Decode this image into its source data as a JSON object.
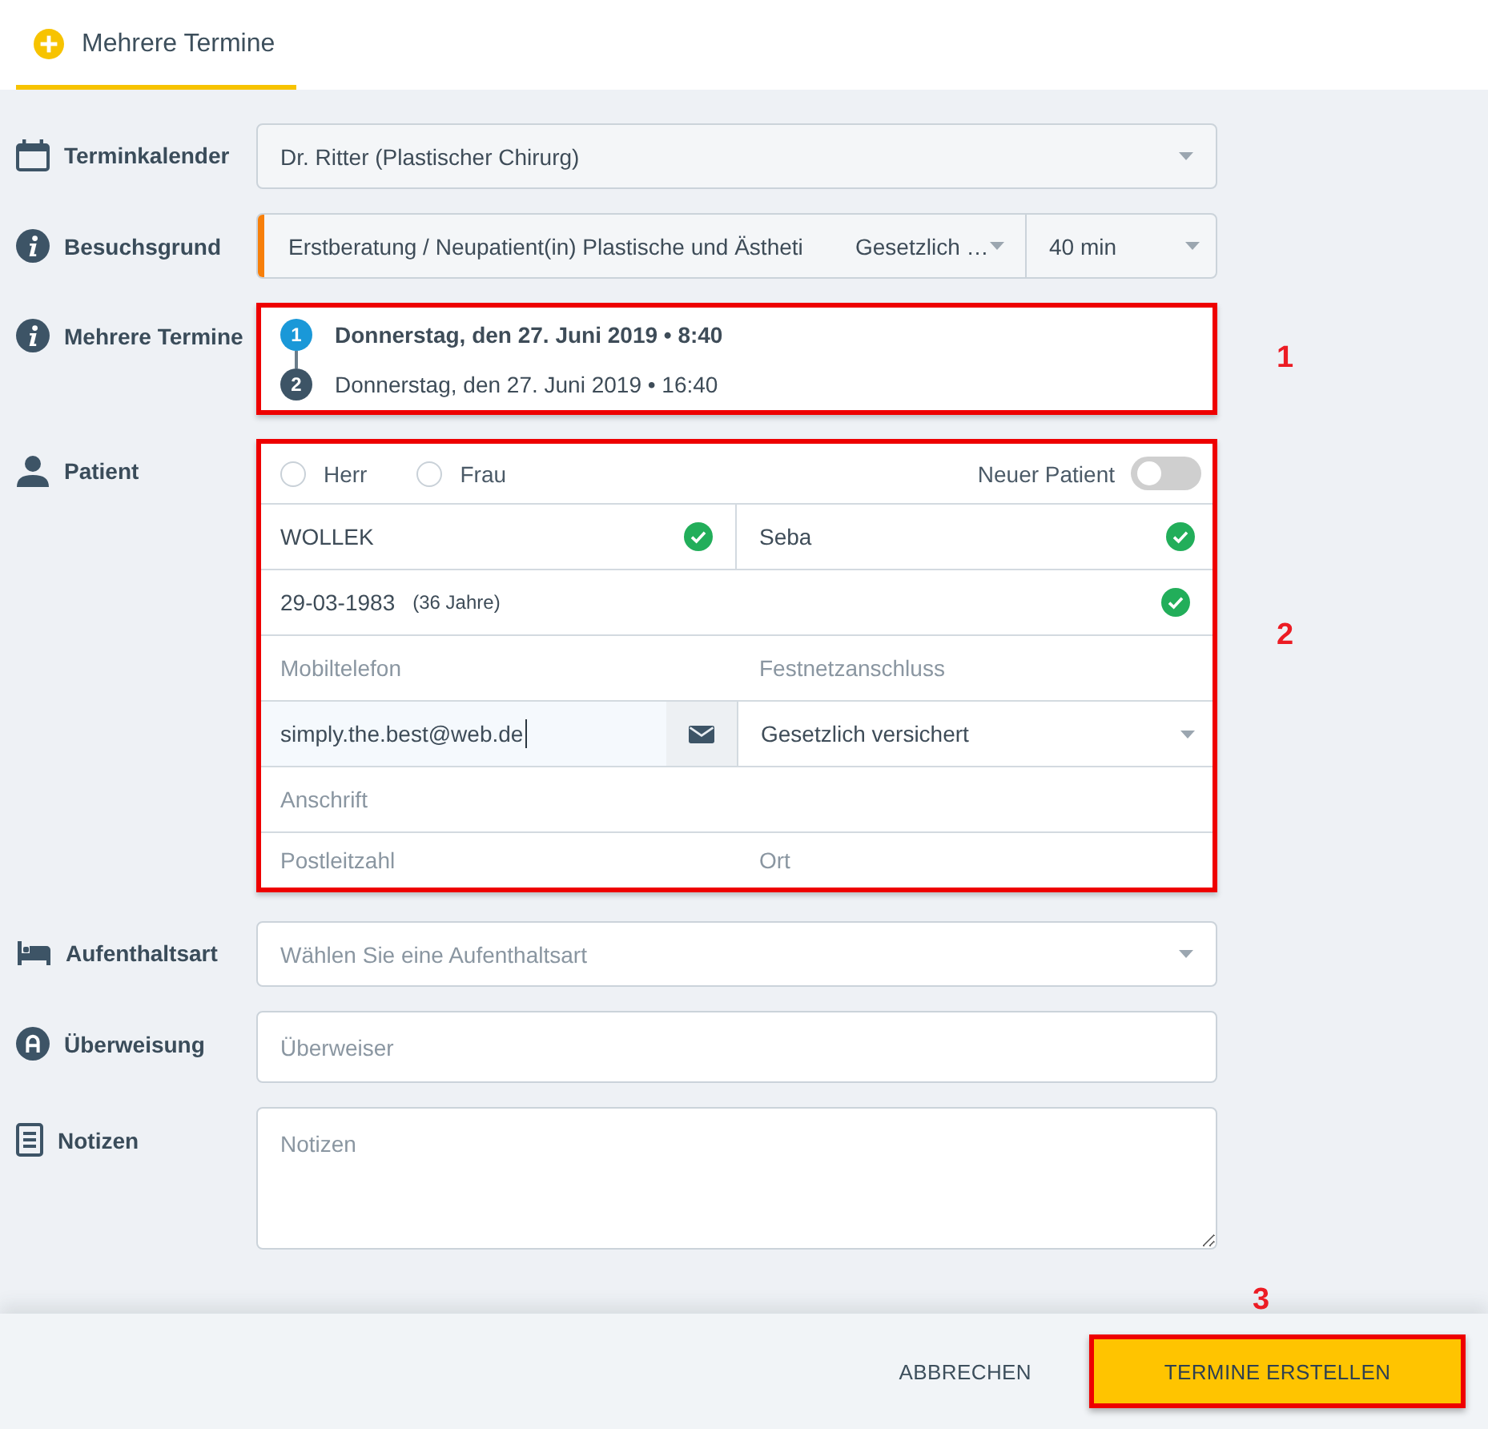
{
  "tab": {
    "label": "Mehrere Termine",
    "selected": true
  },
  "form": {
    "calendar": {
      "label": "Terminkalender",
      "value": "Dr. Ritter (Plastischer Chirurg)"
    },
    "visit_reason": {
      "label": "Besuchsgrund",
      "reason": "Erstberatung / Neupatient(in) Plastische und Ästheti",
      "color": "#f77f0a",
      "insurance": "Gesetzlich …",
      "duration": "40 min"
    },
    "appointments": {
      "label": "Mehrere Termine",
      "annotation": "1",
      "items": [
        {
          "number": "1",
          "text": "Donnerstag, den 27. Juni 2019 • 8:40",
          "selected": true
        },
        {
          "number": "2",
          "text": "Donnerstag, den 27. Juni 2019 • 16:40",
          "selected": false
        }
      ]
    },
    "patient": {
      "label": "Patient",
      "annotation": "2",
      "salutations": [
        {
          "label": "Herr",
          "selected": false
        },
        {
          "label": "Frau",
          "selected": false
        }
      ],
      "new_patient": {
        "label": "Neuer Patient",
        "on": false
      },
      "last_name": {
        "value": "WOLLEK",
        "valid": true
      },
      "first_name": {
        "value": "Seba",
        "valid": true
      },
      "birth_date": {
        "value": "29-03-1983",
        "age": "(36 Jahre)",
        "valid": true
      },
      "mobile_phone": {
        "placeholder": "Mobiltelefon"
      },
      "landline": {
        "placeholder": "Festnetzanschluss"
      },
      "email": {
        "value": "simply.the.best@web.de",
        "focused": true
      },
      "insurance": {
        "value": "Gesetzlich versichert"
      },
      "address": {
        "placeholder": "Anschrift"
      },
      "postal_code": {
        "placeholder": "Postleitzahl"
      },
      "city": {
        "placeholder": "Ort"
      }
    },
    "stay_type": {
      "label": "Aufenthaltsart",
      "placeholder": "Wählen Sie eine Aufenthaltsart"
    },
    "referral": {
      "label": "Überweisung",
      "placeholder": "Überweiser"
    },
    "notes": {
      "label": "Notizen",
      "placeholder": "Notizen"
    }
  },
  "footer": {
    "buttons": [
      {
        "label": "ABBRECHEN",
        "kind": "flat"
      },
      {
        "label": "TERMINE ERSTELLEN",
        "kind": "primary",
        "annotation": "3"
      }
    ]
  }
}
